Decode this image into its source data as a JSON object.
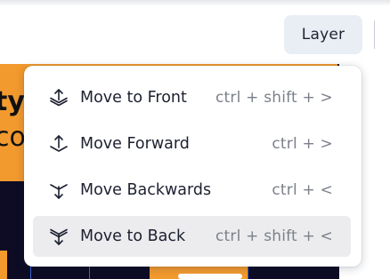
{
  "toolbar": {
    "layer_label": "Layer"
  },
  "canvas": {
    "text_line1": "ty:",
    "text_line2": "col"
  },
  "menu": {
    "items": [
      {
        "label": "Move to Front",
        "shortcut": "ctrl + shift + >",
        "icon": "bring-to-front-icon"
      },
      {
        "label": "Move Forward",
        "shortcut": "ctrl + >",
        "icon": "bring-forward-icon"
      },
      {
        "label": "Move Backwards",
        "shortcut": "ctrl + <",
        "icon": "send-backward-icon"
      },
      {
        "label": "Move to Back",
        "shortcut": "ctrl + shift + <",
        "icon": "send-to-back-icon"
      }
    ],
    "hovered_item": "Move to Back"
  },
  "colors": {
    "accent_orange": "#f29a2e",
    "dark_navy": "#0d0c24",
    "hover_bg": "#ececee",
    "button_bg": "#e9eef5"
  }
}
